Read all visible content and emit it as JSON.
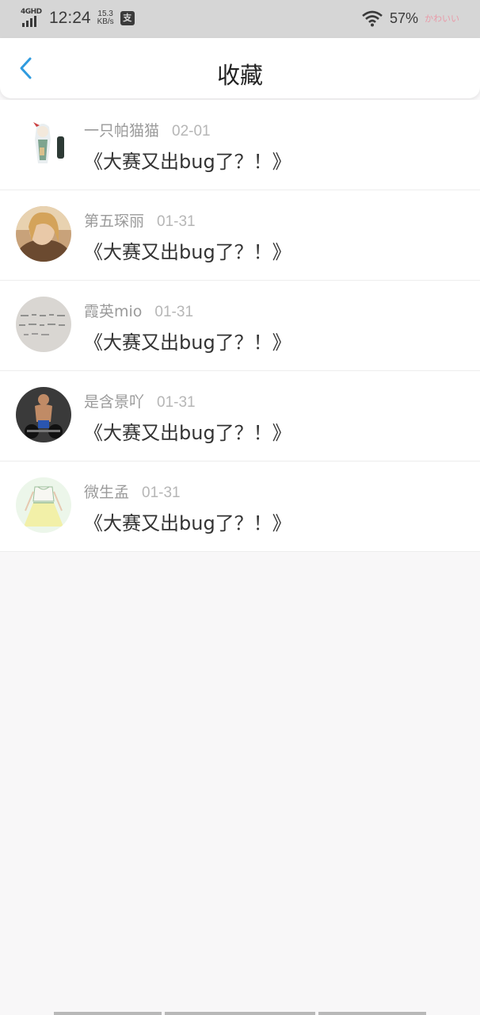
{
  "status_bar": {
    "network": "4GHD",
    "time": "12:24",
    "speed_value": "15.3",
    "speed_unit": "KB/s",
    "app_badge": "支",
    "battery": "57%",
    "carrier_tag": "かわいい"
  },
  "header": {
    "back_icon": "chevron-left-icon",
    "title": "收藏"
  },
  "colors": {
    "accent": "#2f9bdf",
    "background": "#f8f7f8"
  },
  "favorites": [
    {
      "name": "一只帕猫猫",
      "date": "02-01",
      "text": "《大赛又出bug了？！》"
    },
    {
      "name": "第五琛丽",
      "date": "01-31",
      "text": "《大赛又出bug了？！》"
    },
    {
      "name": "霞英mio",
      "date": "01-31",
      "text": "《大赛又出bug了？！》"
    },
    {
      "name": "是含景吖",
      "date": "01-31",
      "text": "《大赛又出bug了？！》"
    },
    {
      "name": "微生孟",
      "date": "01-31",
      "text": "《大赛又出bug了？！》"
    }
  ]
}
